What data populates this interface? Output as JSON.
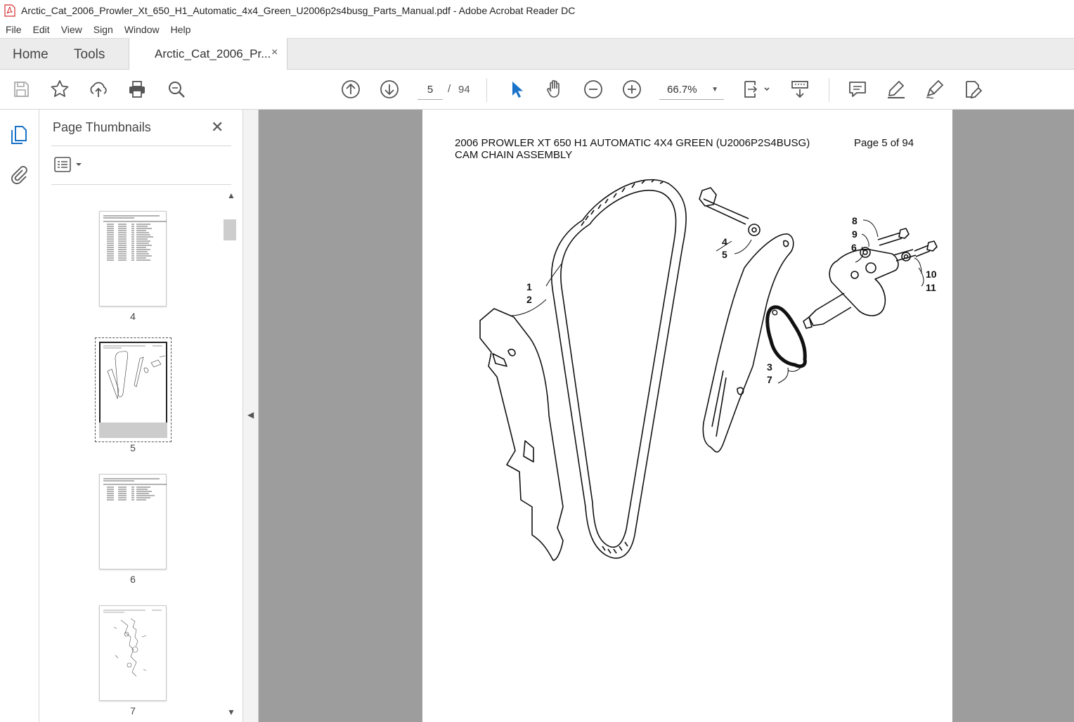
{
  "window": {
    "title": "Arctic_Cat_2006_Prowler_Xt_650_H1_Automatic_4x4_Green_U2006p2s4busg_Parts_Manual.pdf - Adobe Acrobat Reader DC"
  },
  "menu": [
    "File",
    "Edit",
    "View",
    "Sign",
    "Window",
    "Help"
  ],
  "tabs": {
    "home": "Home",
    "tools": "Tools",
    "document": "Arctic_Cat_2006_Pr...",
    "close": "×"
  },
  "toolbar": {
    "current_page": "5",
    "separator": "/",
    "total_pages": "94",
    "zoom": "66.7%"
  },
  "panel": {
    "title": "Page Thumbnails",
    "close": "✕",
    "thumbnails": [
      {
        "label": "4"
      },
      {
        "label": "5"
      },
      {
        "label": "6"
      },
      {
        "label": "7"
      }
    ]
  },
  "document": {
    "header": "2006 PROWLER XT 650 H1 AUTOMATIC 4X4 GREEN (U2006P2S4BUSG)",
    "page_of": "Page 5 of 94",
    "subtitle": "CAM CHAIN ASSEMBLY",
    "callouts": [
      "1",
      "2",
      "4",
      "5",
      "8",
      "9",
      "6",
      "10",
      "11",
      "3",
      "7"
    ]
  }
}
